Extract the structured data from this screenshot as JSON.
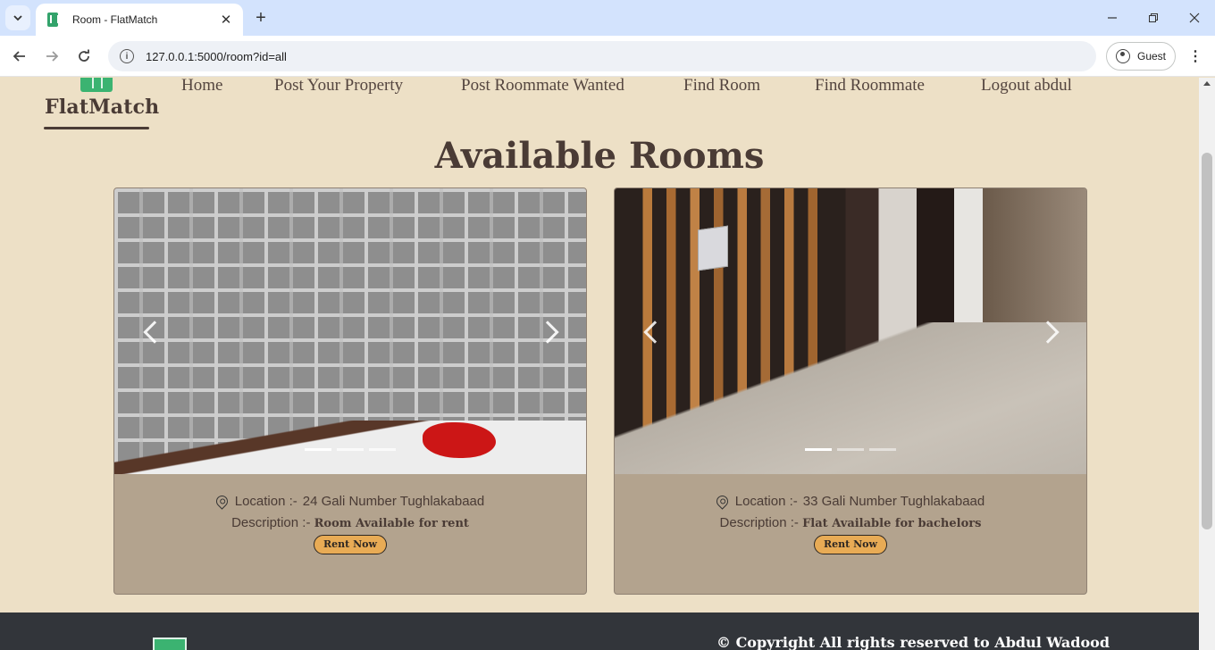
{
  "browser": {
    "tab_title": "Room - FlatMatch",
    "url": "127.0.0.1:5000/room?id=all",
    "profile_label": "Guest"
  },
  "site": {
    "logo_text": "FlatMatch",
    "nav": [
      "Home",
      "Post Your Property",
      "Post Roommate Wanted",
      "Find Room",
      "Find Roommate",
      "Logout abdul"
    ],
    "heading": "Available Rooms",
    "footer_copyright": "© Copyright All rights reserved to Abdul Wadood"
  },
  "rooms": [
    {
      "location_label": "Location :-",
      "location": "24 Gali Number Tughlakabaad",
      "description_label": "Description :-",
      "description": "Room Available for rent",
      "button": "Rent Now",
      "slides": 3,
      "active_slide": 1
    },
    {
      "location_label": "Location :-",
      "location": "33 Gali Number Tughlakabaad",
      "description_label": "Description :-",
      "description": "Flat Available for bachelors",
      "button": "Rent Now",
      "slides": 3,
      "active_slide": 1
    }
  ],
  "icons": {
    "tab_menu": "chevron-down-icon",
    "tab_close": "close-icon",
    "new_tab": "plus-icon",
    "back": "arrow-left-icon",
    "forward": "arrow-right-icon",
    "reload": "reload-icon",
    "site_info": "site-info-icon",
    "profile": "profile-icon",
    "menu": "kebab-menu-icon",
    "location": "location-pin-icon"
  },
  "colors": {
    "page_bg": "#ede0c6",
    "card_bg": "#b3a38e",
    "button_bg": "#e8ab55",
    "text_dark": "#4a3b35",
    "footer_bg": "#32353a",
    "logo_green": "#3bb371"
  }
}
